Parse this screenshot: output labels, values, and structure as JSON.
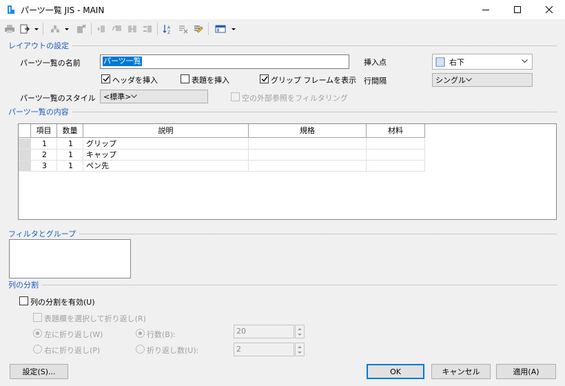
{
  "window": {
    "title": "パーツ一覧 JIS - MAIN",
    "icon": "document-icon",
    "controls": [
      "minimize-icon",
      "maximize-icon",
      "close-icon"
    ]
  },
  "toolbar": {
    "icons": [
      "print-icon",
      "export-icon",
      "link-icon",
      "delete-column-icon",
      "insert-column-left-icon",
      "insert-column-right-icon",
      "move-column-icon",
      "merge-icon",
      "sort-icon",
      "clear-icon",
      "edit-icon",
      "view-options-icon"
    ]
  },
  "layout": {
    "group_title": "レイアウトの設定",
    "name_label": "パーツ一覧の名前",
    "name_value": "パーツ一覧",
    "insert_point_label": "挿入点",
    "insert_point_value": "右下",
    "header_checkbox": "ヘッダを挿入",
    "header_checked": true,
    "title_checkbox": "表題を挿入",
    "title_checked": false,
    "grip_checkbox": "グリップ フレームを表示",
    "grip_checked": true,
    "row_spacing_label": "行間隔",
    "row_spacing_value": "シングル",
    "style_label": "パーツ一覧のスタイル",
    "style_value": "<標準>",
    "filter_empty_label": "空の外部参照をフィルタリング",
    "filter_empty_checked": false
  },
  "contents": {
    "group_title": "パーツ一覧の内容",
    "columns": [
      "項目",
      "数量",
      "説明",
      "規格",
      "材料"
    ],
    "rows": [
      {
        "item": "1",
        "qty": "1",
        "desc": "グリップ",
        "spec": "",
        "material": ""
      },
      {
        "item": "2",
        "qty": "1",
        "desc": "キャップ",
        "spec": "",
        "material": ""
      },
      {
        "item": "3",
        "qty": "1",
        "desc": "ペン先",
        "spec": "",
        "material": ""
      }
    ]
  },
  "filter": {
    "group_title": "フィルタとグループ"
  },
  "split": {
    "group_title": "列の分割",
    "enable_label": "列の分割を有効(U)",
    "enable_checked": false,
    "select_title_label": "表題欄を選択して折り返し(R)",
    "wrap_left_label": "左に折り返し(W)",
    "wrap_right_label": "右に折り返し(P)",
    "rows_label": "行数(B):",
    "rows_value": "20",
    "wrap_count_label": "折り返し数(U):",
    "wrap_count_value": "2"
  },
  "buttons": {
    "settings": "設定(S)...",
    "ok": "OK",
    "cancel": "キャンセル",
    "apply": "適用(A)"
  },
  "colors": {
    "accent": "#0078d7",
    "group_title": "#1b5bbf",
    "selection": "#0078d7"
  }
}
